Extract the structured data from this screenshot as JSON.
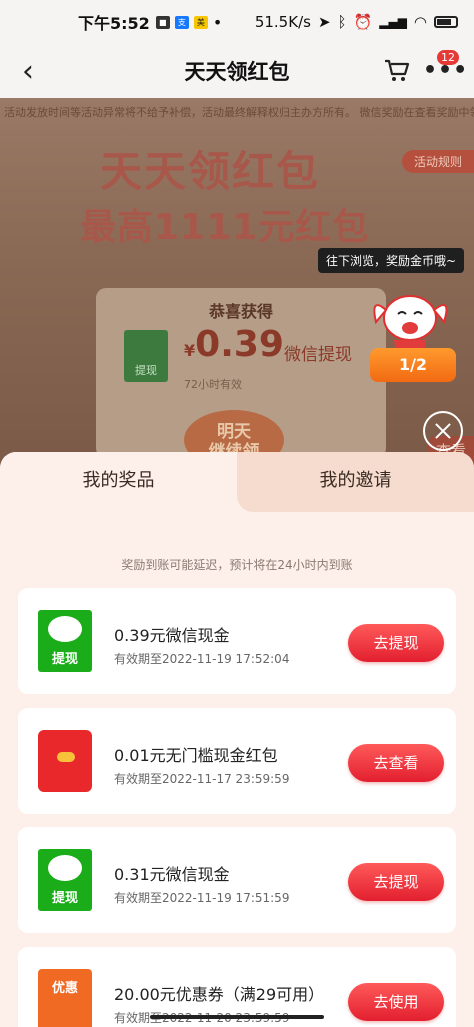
{
  "status_bar": {
    "time": "下午5:52",
    "speed": "51.5K/s",
    "battery_icon": "battery-icon"
  },
  "header": {
    "title": "天天领红包",
    "cart_badge": "12"
  },
  "background_page": {
    "notice": "活动发放时间等活动异常将不给予补偿，活动最终解释权归主办方所有。 微信奖励在查看奖励中领取，奖励到账后",
    "rules_label": "活动规则",
    "banner_title": "天天领红包",
    "banner_subtitle": "最高1111元红包",
    "congrats": "恭喜获得",
    "amount_symbol": "¥",
    "amount": "0.39",
    "amount_label": "微信提现",
    "valid_hours": "72小时有效",
    "tomorrow_label": "明天\n继续领",
    "wx_badge": "提现",
    "check_label": "查看"
  },
  "widget": {
    "tooltip": "往下浏览，奖励金币哦~",
    "progress": "1/2"
  },
  "sheet": {
    "tabs": [
      {
        "label": "我的奖品",
        "active": true
      },
      {
        "label": "我的邀请",
        "active": false
      }
    ],
    "hint": "奖励到账可能延迟，预计将在24小时内到账",
    "prizes": [
      {
        "icon": "wechat-withdraw-icon",
        "icon_label": "提现",
        "name": "0.39元微信现金",
        "expiry": "有效期至2022-11-19 17:52:04",
        "action": "去提现"
      },
      {
        "icon": "red-packet-icon",
        "icon_label": "",
        "name": "0.01元无门槛现金红包",
        "expiry": "有效期至2022-11-17 23:59:59",
        "action": "去查看"
      },
      {
        "icon": "wechat-withdraw-icon",
        "icon_label": "提现",
        "name": "0.31元微信现金",
        "expiry": "有效期至2022-11-19 17:51:59",
        "action": "去提现"
      },
      {
        "icon": "coupon-icon",
        "icon_label": "优惠",
        "name": "20.00元优惠券（满29可用）",
        "expiry": "有效期至2022-11-20 23:59:59",
        "action": "去使用"
      }
    ]
  },
  "colors": {
    "accent": "#e21f2f",
    "wechat": "#1aad19",
    "sheet_bg": "#fdf0ea"
  }
}
